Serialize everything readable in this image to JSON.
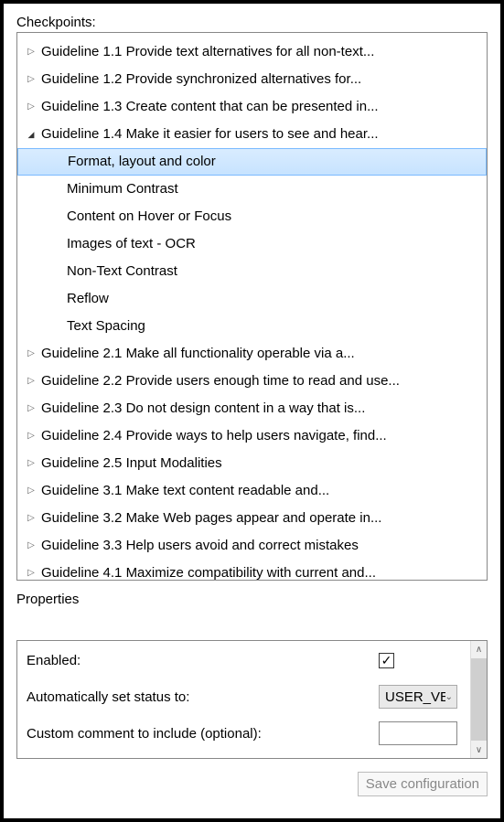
{
  "labels": {
    "checkpoints": "Checkpoints:",
    "properties": "Properties",
    "enabled": "Enabled:",
    "auto_status": "Automatically set status to:",
    "custom_comment": "Custom comment to include (optional):",
    "save": "Save configuration"
  },
  "tree": {
    "items": [
      {
        "text": "Guideline 1.1 Provide text alternatives for all non-text...",
        "expanded": false,
        "level": 0,
        "parent": true,
        "selected": false
      },
      {
        "text": "Guideline 1.2 Provide synchronized alternatives for...",
        "expanded": false,
        "level": 0,
        "parent": true,
        "selected": false
      },
      {
        "text": "Guideline 1.3 Create content that can be presented in...",
        "expanded": false,
        "level": 0,
        "parent": true,
        "selected": false
      },
      {
        "text": "Guideline 1.4 Make it easier for users to see and hear...",
        "expanded": true,
        "level": 0,
        "parent": true,
        "selected": false
      },
      {
        "text": "Format, layout and color",
        "expanded": false,
        "level": 1,
        "parent": false,
        "selected": true
      },
      {
        "text": "Minimum Contrast",
        "expanded": false,
        "level": 1,
        "parent": false,
        "selected": false
      },
      {
        "text": "Content on Hover or Focus",
        "expanded": false,
        "level": 1,
        "parent": false,
        "selected": false
      },
      {
        "text": "Images of text - OCR",
        "expanded": false,
        "level": 1,
        "parent": false,
        "selected": false
      },
      {
        "text": "Non-Text Contrast",
        "expanded": false,
        "level": 1,
        "parent": false,
        "selected": false
      },
      {
        "text": "Reflow",
        "expanded": false,
        "level": 1,
        "parent": false,
        "selected": false
      },
      {
        "text": "Text Spacing",
        "expanded": false,
        "level": 1,
        "parent": false,
        "selected": false
      },
      {
        "text": "Guideline 2.1 Make all functionality operable via a...",
        "expanded": false,
        "level": 0,
        "parent": true,
        "selected": false
      },
      {
        "text": "Guideline 2.2 Provide users enough time to read and use...",
        "expanded": false,
        "level": 0,
        "parent": true,
        "selected": false
      },
      {
        "text": "Guideline 2.3 Do not design content in a way that is...",
        "expanded": false,
        "level": 0,
        "parent": true,
        "selected": false
      },
      {
        "text": "Guideline 2.4 Provide ways to help users navigate, find...",
        "expanded": false,
        "level": 0,
        "parent": true,
        "selected": false
      },
      {
        "text": "Guideline 2.5 Input Modalities",
        "expanded": false,
        "level": 0,
        "parent": true,
        "selected": false
      },
      {
        "text": "Guideline 3.1 Make text content readable and...",
        "expanded": false,
        "level": 0,
        "parent": true,
        "selected": false
      },
      {
        "text": "Guideline 3.2 Make Web pages appear and operate in...",
        "expanded": false,
        "level": 0,
        "parent": true,
        "selected": false
      },
      {
        "text": "Guideline 3.3 Help users avoid and correct mistakes",
        "expanded": false,
        "level": 0,
        "parent": true,
        "selected": false
      },
      {
        "text": "Guideline 4.1 Maximize compatibility with current and...",
        "expanded": false,
        "level": 0,
        "parent": true,
        "selected": false
      }
    ]
  },
  "properties": {
    "enabled_checked": true,
    "status_value": "USER_VE",
    "comment_value": ""
  },
  "icons": {
    "check": "✓",
    "caret_down": "⌄",
    "scroll_up": "∧",
    "scroll_down": "∨"
  }
}
